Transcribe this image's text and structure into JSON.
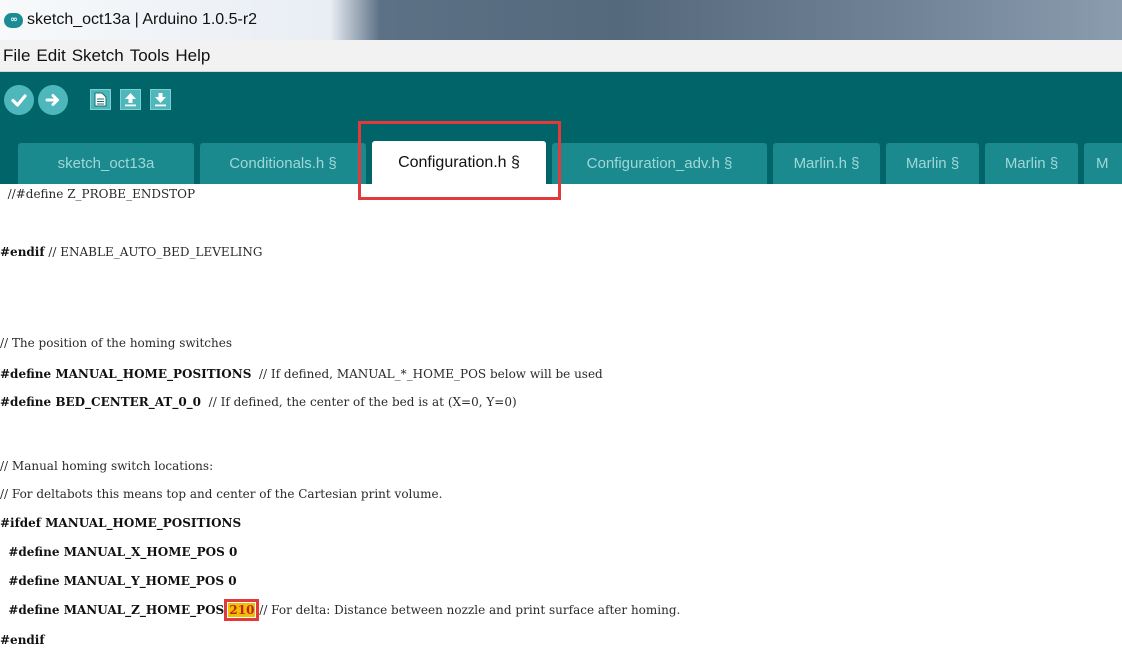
{
  "window": {
    "title": "sketch_oct13a | Arduino 1.0.5-r2",
    "logo": "∞"
  },
  "menu": [
    "File",
    "Edit",
    "Sketch",
    "Tools",
    "Help"
  ],
  "toolbar": {
    "buttons": [
      "verify-icon",
      "upload-icon",
      "new-icon",
      "open-icon",
      "save-icon"
    ],
    "accent": "#006468",
    "button_color": "#4db7bb"
  },
  "tabs": [
    {
      "label": "sketch_oct13a",
      "active": false
    },
    {
      "label": "Conditionals.h §",
      "active": false
    },
    {
      "label": "Configuration.h §",
      "active": true
    },
    {
      "label": "Configuration_adv.h §",
      "active": false
    },
    {
      "label": "Marlin.h §",
      "active": false
    },
    {
      "label": "Marlin §",
      "active": false
    },
    {
      "label": "Marlin §",
      "active": false
    },
    {
      "label": "M",
      "active": false
    }
  ],
  "code": {
    "l1": "  //#define Z_PROBE_ENDSTOP",
    "l2_kw": "#endif",
    "l2_rest": " // ENABLE_AUTO_BED_LEVELING",
    "l3": "// The position of the homing switches",
    "l4_kw": "#define MANUAL_HOME_POSITIONS",
    "l4_rest": "  // If defined, MANUAL_*_HOME_POS below will be used",
    "l5_kw": "#define BED_CENTER_AT_0_0",
    "l5_rest": "  // If defined, the center of the bed is at (X=0, Y=0)",
    "l6": "// Manual homing switch locations:",
    "l7": "// For deltabots this means top and center of the Cartesian print volume.",
    "l8_kw": "#ifdef MANUAL_HOME_POSITIONS",
    "l9_kw": "  #define MANUAL_X_HOME_POS 0",
    "l10_kw": "  #define MANUAL_Y_HOME_POS 0",
    "l11_kw": "  #define MANUAL_Z_HOME_POS ",
    "l11_value": "210",
    "l11_rest": " // For delta: Distance between nozzle and print surface after homing.",
    "l12_kw": "#endif"
  },
  "colors": {
    "highlight_box": "#e23a3a",
    "value_highlight": "#f0c000"
  }
}
